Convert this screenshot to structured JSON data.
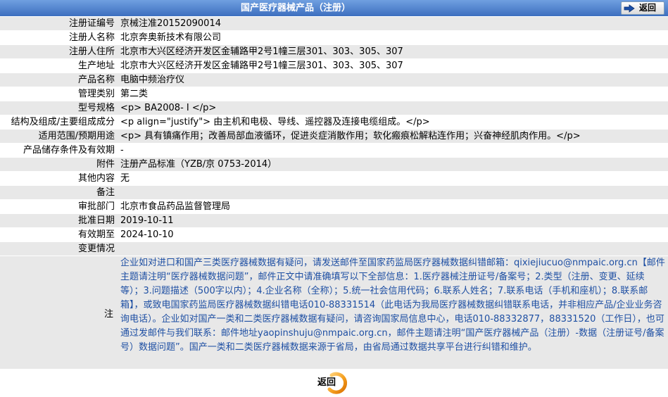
{
  "header": {
    "title": "国产医疗器械产品（注册）",
    "back_label": "返回",
    "back_icon": "arrow-right-icon"
  },
  "rows": [
    {
      "label": "注册证编号",
      "value": "京械注准20152090014"
    },
    {
      "label": "注册人名称",
      "value": "北京奔奥新技术有限公司"
    },
    {
      "label": "注册人住所",
      "value": "北京市大兴区经济开发区金辅路甲2号1幢三层301、303、305、307"
    },
    {
      "label": "生产地址",
      "value": "北京市大兴区经济开发区金辅路甲2号1幢三层301、303、305、307"
    },
    {
      "label": "产品名称",
      "value": "电脑中频治疗仪"
    },
    {
      "label": "管理类别",
      "value": "第二类"
    },
    {
      "label": "型号规格",
      "value": "<p> BA2008- Ⅰ </p>"
    },
    {
      "label": "结构及组成/主要组成成分",
      "value": "<p align=\"justify\"> 由主机和电极、导线、遥控器及连接电缆组成。</p>"
    },
    {
      "label": "适用范围/预期用途",
      "value": "<p> 具有镇痛作用；改善局部血液循环，促进炎症消散作用；软化瘢痕松解粘连作用；兴奋神经肌肉作用。</p>"
    },
    {
      "label": "产品储存条件及有效期",
      "value": "-"
    },
    {
      "label": "附件",
      "value": "注册产品标准（YZB/京 0753-2014）"
    },
    {
      "label": "其他内容",
      "value": "无"
    },
    {
      "label": "备注"
    },
    {
      "label": "审批部门",
      "value": "北京市食品药品监督管理局"
    },
    {
      "label": "批准日期",
      "value": "2019-10-11"
    },
    {
      "label": "有效期至",
      "value": "2024-10-10"
    },
    {
      "label": "变更情况"
    }
  ],
  "note": {
    "label": "注",
    "text": "企业如对进口和国产三类医疗器械数据有疑问，请发送邮件至国家药监局医疗器械数据纠错邮箱：qixiejiucuo@nmpaic.org.cn【邮件主题请注明“医疗器械数据问题”，邮件正文中请准确填写以下全部信息：1.医疗器械注册证号/备案号；2.类型（注册、变更、延续等）；3.问题描述（500字以内）；4.企业名称（全称）；5.统一社会信用代码；6.联系人姓名；7.联系电话（手机和座机）；8.联系邮箱】，或致电国家药监局医疗器械数据纠错电话010-88331514（此电话为我局医疗器械数据纠错联系电话，并非相应产品/企业业务咨询电话）。企业如对国产一类和二类医疗器械数据有疑问，请咨询国家局信息中心，电话010-88332877，88331520（工作日），也可通过发邮件与我们联系：邮件地址yaopinshuju@nmpaic.org.cn，邮件主题请注明“国产医疗器械产品（注册）-数据（注册证号/备案号）数据问题”。国产一类和二类医疗器械数据来源于省局，由省局通过数据共享平台进行纠错和维护。"
  },
  "footer": {
    "back_label": "返回",
    "back_icon": "orange-ring-icon"
  },
  "colors": {
    "header_top": "#6f9fe0",
    "header_bottom": "#3d6fbf",
    "stripe_gray": "#e8e8e8",
    "stripe_white": "#ffffff",
    "note_text": "#1e4fa3"
  }
}
